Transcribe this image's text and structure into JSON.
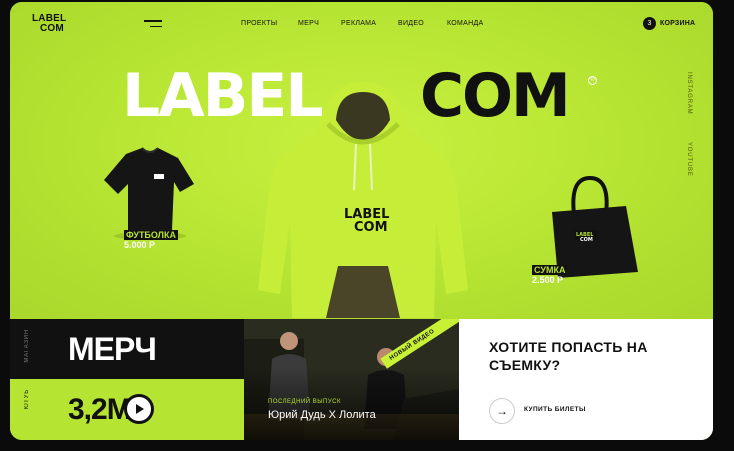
{
  "header": {
    "logo_line1": "LABEL",
    "logo_line2": "COM",
    "nav": [
      "ПРОЕКТЫ",
      "МЕРЧ",
      "РЕКЛАМА",
      "ВИДЕО",
      "КОМАНДА"
    ],
    "cart_count": "3",
    "cart_label": "КОРЗИНА"
  },
  "hero": {
    "title_part1": "LABEL",
    "title_part2": "COM",
    "registered_mark": "®",
    "hoodie_print_line1": "LABEL",
    "hoodie_print_line2": "COM",
    "social": [
      "INSTAGRAM",
      "YOUTUBE"
    ]
  },
  "products": [
    {
      "name": "ФУТБОЛКА",
      "price": "5.000 Р"
    },
    {
      "name": "СУМКА",
      "price": "2.500 Р"
    }
  ],
  "merch": {
    "section_label": "МАГАЗИН",
    "title": "МЕРЧ"
  },
  "stats": {
    "label": "ЮТУБ",
    "value": "3,2M"
  },
  "video": {
    "tape_text": "НОВЫЙ ВИДЕО",
    "caption": "ПОСЛЕДНИЙ ВЫПУСК",
    "title": "Юрий Дудь X Лолита"
  },
  "cta": {
    "title": "ХОТИТЕ ПОПАСТЬ НА СЪЕМКУ?",
    "button_label": "КУПИТЬ БИЛЕТЫ",
    "arrow_icon": "arrow-right-icon"
  },
  "colors": {
    "accent": "#b6e432",
    "dark": "#111111",
    "light": "#ffffff"
  }
}
